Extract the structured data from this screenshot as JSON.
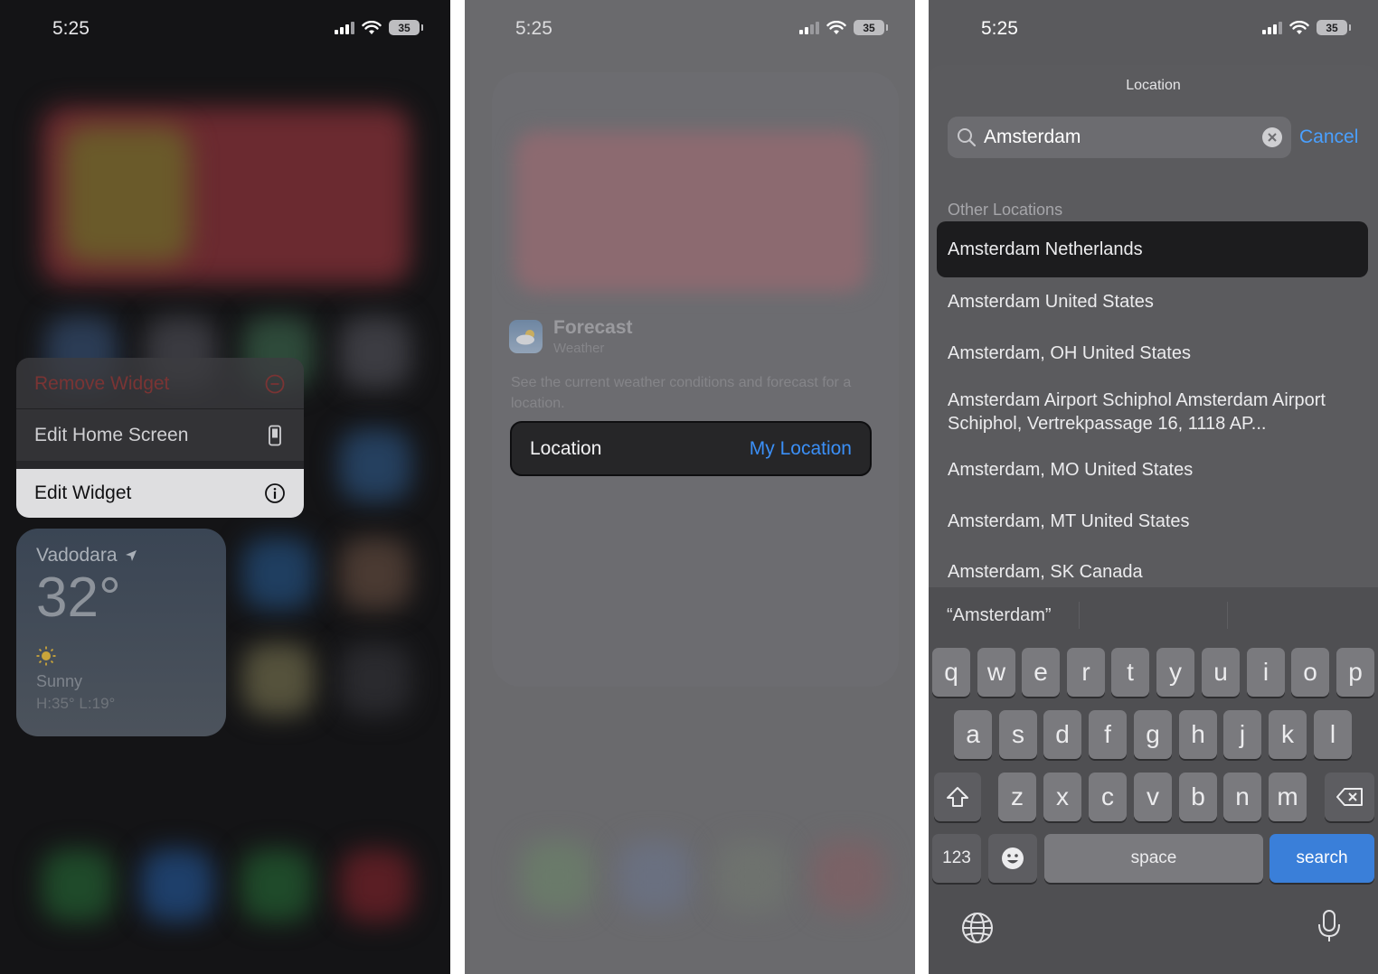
{
  "panel1": {
    "status": {
      "time": "5:25",
      "battery": "35"
    },
    "menu": {
      "remove_widget": "Remove Widget",
      "edit_home_screen": "Edit Home Screen",
      "edit_widget": "Edit Widget"
    },
    "weather_widget": {
      "city": "Vadodara",
      "temperature": "32°",
      "condition": "Sunny",
      "high_low": "H:35° L:19°"
    }
  },
  "panel2": {
    "status": {
      "time": "5:25",
      "battery": "35"
    },
    "widget": {
      "title": "Forecast",
      "subtitle": "Weather",
      "description": "See the current weather conditions and forecast for a location."
    },
    "location_row": {
      "label": "Location",
      "value": "My Location"
    }
  },
  "panel3": {
    "status": {
      "time": "5:25",
      "battery": "35"
    },
    "title": "Location",
    "search": {
      "value": "Amsterdam",
      "cancel_label": "Cancel"
    },
    "section_header": "Other Locations",
    "results": [
      "Amsterdam Netherlands",
      "Amsterdam United States",
      "Amsterdam, OH United States",
      "Amsterdam Airport Schiphol Amsterdam Airport Schiphol, Vertrekpassage 16, 1118 AP...",
      "Amsterdam, MO United States",
      "Amsterdam, MT United States",
      "Amsterdam, SK Canada"
    ],
    "keyboard": {
      "suggestion": "“Amsterdam”",
      "row1": [
        "q",
        "w",
        "e",
        "r",
        "t",
        "y",
        "u",
        "i",
        "o",
        "p"
      ],
      "row2": [
        "a",
        "s",
        "d",
        "f",
        "g",
        "h",
        "j",
        "k",
        "l"
      ],
      "row3": [
        "z",
        "x",
        "c",
        "v",
        "b",
        "n",
        "m"
      ],
      "numbers_label": "123",
      "space_label": "space",
      "search_label": "search"
    }
  },
  "colors": {
    "accent_blue": "#3b8ff6",
    "search_key": "#3a7fd9",
    "destructive": "#7a3434"
  }
}
